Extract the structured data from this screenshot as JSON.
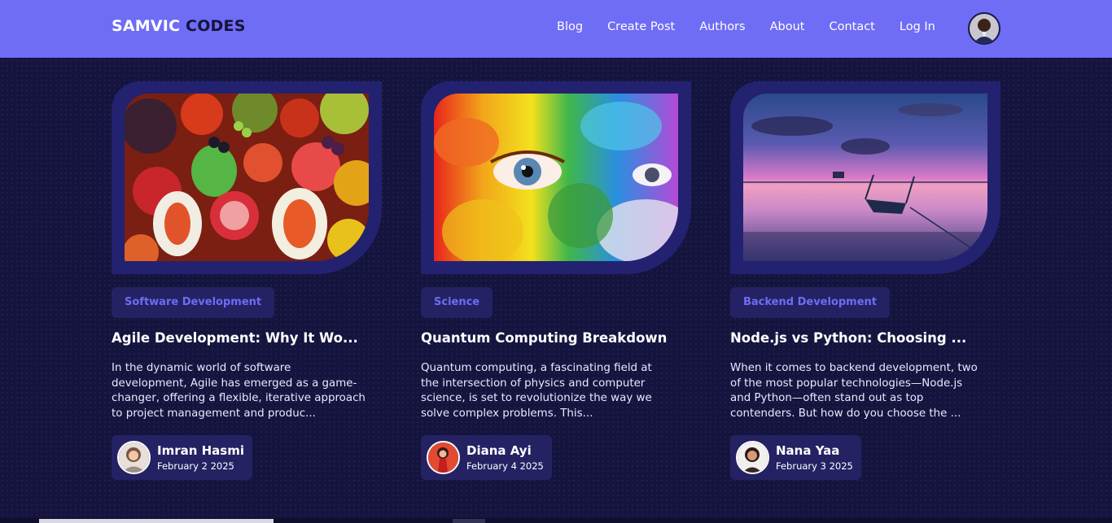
{
  "brand": {
    "part1": "SAMVIC",
    "part2": "CODES"
  },
  "nav": {
    "links": [
      "Blog",
      "Create Post",
      "Authors",
      "About",
      "Contact",
      "Log In"
    ],
    "avatar_icon": "user-avatar-icon"
  },
  "colors": {
    "navbar": "#6f6cf5",
    "background": "#15143f",
    "card_frame": "#232271",
    "chip_background": "#242263",
    "accent": "#6f6cf5"
  },
  "posts": [
    {
      "category": "Software Development",
      "title": "Agile Development: Why It Wo...",
      "excerpt": [
        "In the dynamic world of software",
        "development, Agile has emerged as a game-",
        "changer, offering a flexible, iterative approach",
        "to project management and produc..."
      ],
      "image": "fruits-photo",
      "author": {
        "name": "Imran Hasmi",
        "date": "February 2 2025"
      }
    },
    {
      "category": "Science",
      "title": "Quantum Computing Breakdown",
      "excerpt": [
        "Quantum computing, a fascinating field at",
        "the intersection of physics and computer",
        "science, is set to revolutionize the way we",
        "solve complex problems. This..."
      ],
      "image": "painted-face-photo",
      "author": {
        "name": "Diana Ayi",
        "date": "February 4 2025"
      }
    },
    {
      "category": "Backend Development",
      "title": "Node.js vs Python: Choosing ...",
      "excerpt": [
        "When it comes to backend development, two",
        "of the most popular technologies—Node.js",
        "and Python—often stand out as top",
        "contenders. But how do you choose the ..."
      ],
      "image": "sunset-lake-boat-photo",
      "author": {
        "name": "Nana Yaa",
        "date": "February 3 2025"
      }
    }
  ]
}
